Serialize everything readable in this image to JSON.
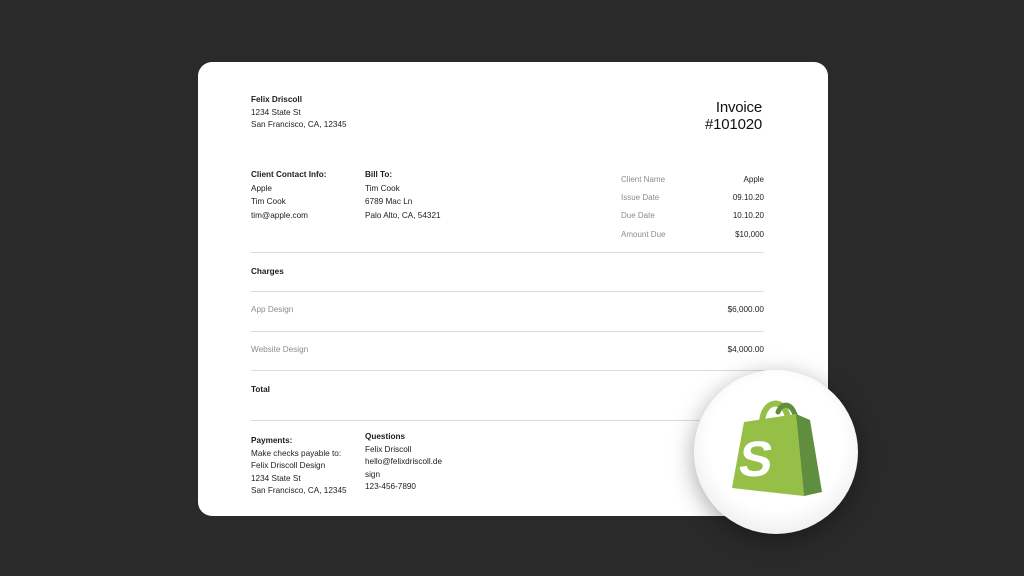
{
  "sender": {
    "name": "Felix Driscoll",
    "street": "1234 State St",
    "city": "San Francisco, CA, 12345"
  },
  "invoice": {
    "label": "Invoice",
    "number": "#101020"
  },
  "client_contact": {
    "heading": "Client Contact Info:",
    "company": "Apple",
    "person": "Tim Cook",
    "email": "tim@apple.com"
  },
  "bill_to": {
    "heading": "Bill To:",
    "name": "Tim Cook",
    "street": "6789 Mac Ln",
    "city": "Palo Alto, CA, 54321"
  },
  "summary": [
    {
      "label": "Client Name",
      "value": "Apple"
    },
    {
      "label": "Issue Date",
      "value": "09.10.20"
    },
    {
      "label": "Due Date",
      "value": "10.10.20"
    },
    {
      "label": "Amount Due",
      "value": "$10,000"
    }
  ],
  "charges": {
    "heading": "Charges",
    "items": [
      {
        "label": "App Design",
        "amount": "$6,000.00"
      },
      {
        "label": "Website Design",
        "amount": "$4,000.00"
      }
    ],
    "total_label": "Total"
  },
  "payments": {
    "heading": "Payments:",
    "lines": [
      "Make checks payable to:",
      "Felix Driscoll Design",
      "1234 State St",
      "San Francisco, CA, 12345"
    ]
  },
  "questions": {
    "heading": "Questions",
    "lines": [
      "Felix Driscoll",
      "hello@felixdriscoll.de",
      "sign",
      "123-456-7890"
    ]
  },
  "logo": {
    "icon": "shopify-bag-icon",
    "colors": {
      "bag_light": "#95bf47",
      "bag_dark": "#5e8e3e",
      "letter": "#ffffff"
    }
  }
}
